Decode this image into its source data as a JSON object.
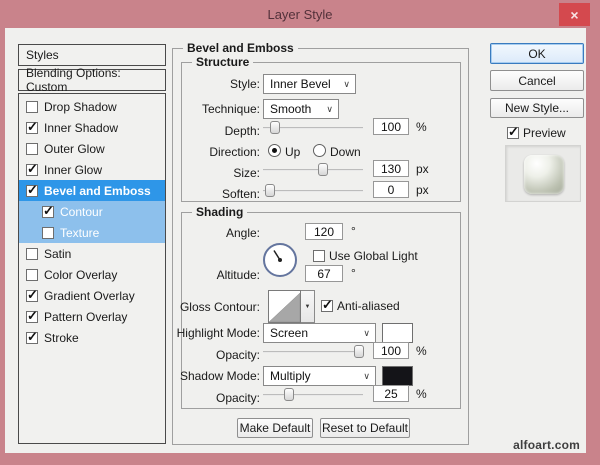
{
  "window": {
    "title": "Layer Style",
    "close": "×"
  },
  "icons": {
    "chevron_down": "∨",
    "combo_arrow": "▼",
    "check": "✓"
  },
  "sidebar": {
    "header": "Styles",
    "blending_options": "Blending Options: Custom",
    "items": [
      {
        "label": "Drop Shadow",
        "checked": false
      },
      {
        "label": "Inner Shadow",
        "checked": true
      },
      {
        "label": "Outer Glow",
        "checked": false
      },
      {
        "label": "Inner Glow",
        "checked": true
      },
      {
        "label": "Bevel and Emboss",
        "checked": true,
        "selected": true
      },
      {
        "label": "Contour",
        "checked": true,
        "sub": true
      },
      {
        "label": "Texture",
        "checked": false,
        "sub": true
      },
      {
        "label": "Satin",
        "checked": false
      },
      {
        "label": "Color Overlay",
        "checked": false
      },
      {
        "label": "Gradient Overlay",
        "checked": true
      },
      {
        "label": "Pattern Overlay",
        "checked": true
      },
      {
        "label": "Stroke",
        "checked": true
      }
    ]
  },
  "panel": {
    "legend": "Bevel and Emboss",
    "structure": {
      "legend": "Structure",
      "style_label": "Style:",
      "style_value": "Inner Bevel",
      "technique_label": "Technique:",
      "technique_value": "Smooth",
      "depth_label": "Depth:",
      "depth_value": "100",
      "depth_unit": "%",
      "direction_label": "Direction:",
      "direction_up": "Up",
      "direction_down": "Down",
      "direction_selected": "Up",
      "size_label": "Size:",
      "size_value": "130",
      "size_unit": "px",
      "soften_label": "Soften:",
      "soften_value": "0",
      "soften_unit": "px"
    },
    "shading": {
      "legend": "Shading",
      "angle_label": "Angle:",
      "angle_value": "120",
      "angle_unit": "°",
      "use_global_light_label": "Use Global Light",
      "use_global_light_checked": false,
      "altitude_label": "Altitude:",
      "altitude_value": "67",
      "altitude_unit": "°",
      "gloss_contour_label": "Gloss Contour:",
      "antialiased_label": "Anti-aliased",
      "antialiased_checked": true,
      "highlight_mode_label": "Highlight Mode:",
      "highlight_mode_value": "Screen",
      "highlight_swatch": "#ffffff",
      "highlight_opacity_label": "Opacity:",
      "highlight_opacity_value": "100",
      "highlight_opacity_unit": "%",
      "shadow_mode_label": "Shadow Mode:",
      "shadow_mode_value": "Multiply",
      "shadow_swatch": "#141418",
      "shadow_opacity_label": "Opacity:",
      "shadow_opacity_value": "25",
      "shadow_opacity_unit": "%"
    },
    "make_default": "Make Default",
    "reset_default": "Reset to Default"
  },
  "actions": {
    "ok": "OK",
    "cancel": "Cancel",
    "new_style": "New Style...",
    "preview_label": "Preview",
    "preview_checked": true
  },
  "footer": {
    "watermark": "alfoart.com"
  },
  "colors": {
    "titlebar": "#c9838b",
    "close_button": "#d4494e",
    "dialog_bg": "#f0f0ee",
    "selected_item": "#2e96e8",
    "sub_item_highlight": "#8dc0ec"
  }
}
